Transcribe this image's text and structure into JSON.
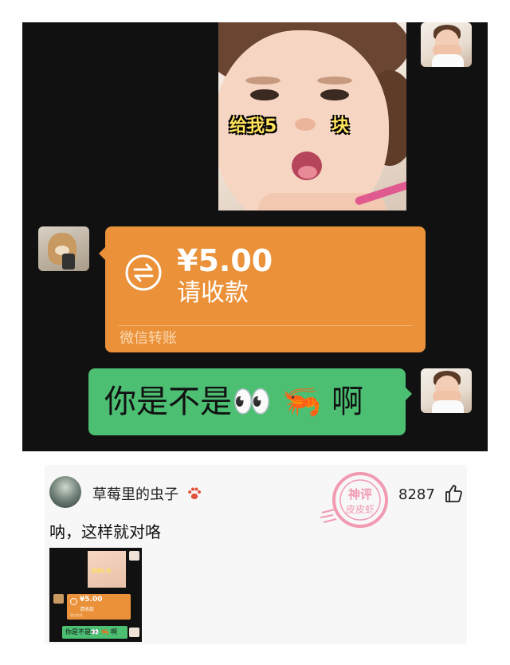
{
  "chat": {
    "photo_caption_part1": "给我5",
    "photo_caption_part2": "块",
    "transfer": {
      "amount": "¥5.00",
      "status": "请收款",
      "label": "微信转账"
    },
    "reply_message": "你是不是👀 🦐 啊"
  },
  "comment": {
    "username": "草莓里的虫子",
    "like_count": "8287",
    "text": "呐，这样就对咯",
    "stamp_text_top": "神评",
    "stamp_text_bottom": "皮皮虾",
    "thumbnail": {
      "caption": "给我5   块",
      "amount": "¥5.00",
      "status": "请收款",
      "label": "微信转账",
      "reply": "你是不是👀 🦐 啊"
    }
  },
  "colors": {
    "chat_bg": "#111111",
    "transfer_orange": "#ea9139",
    "bubble_green": "#4cbf73",
    "card_bg": "#f7f7f7",
    "stamp_pink": "#f08aa6"
  },
  "icons": [
    "transfer-arrows-icon",
    "paw-icon",
    "thumbs-up-icon",
    "shrimp-emoji",
    "eyes-emoji"
  ]
}
